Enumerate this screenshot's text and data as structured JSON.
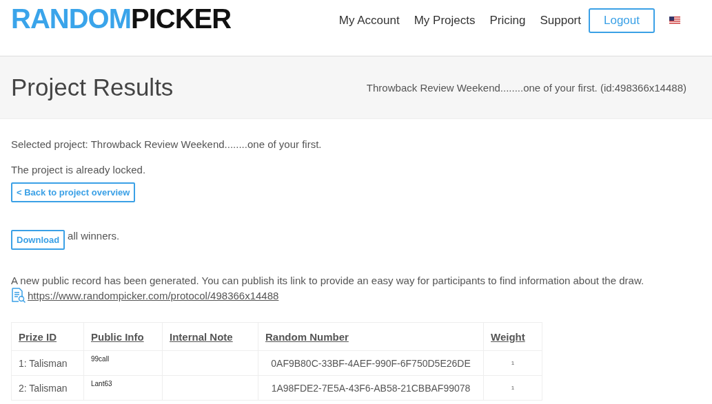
{
  "logo": {
    "first": "RANDOM",
    "second": "PICKER"
  },
  "nav": [
    "My Account",
    "My Projects",
    "Pricing",
    "Support"
  ],
  "logout": "Logout",
  "page": {
    "title": "Project Results",
    "subtitle": "Throwback Review Weekend........one of your first. (id:498366x14488)"
  },
  "selected_project": "Selected project: Throwback Review Weekend........one of your first.",
  "locked_note": "The project is already locked.",
  "back_button": "< Back to project overview",
  "download_button": "Download",
  "download_suffix": "all winners.",
  "record_note": "A new public record has been generated. You can publish its link to provide an easy way for participants to find information about the draw.",
  "record_link": "https://www.randompicker.com/protocol/498366x14488",
  "table": {
    "columns": [
      "Prize ID",
      "Public Info",
      "Internal Note",
      "Random Number",
      "Weight"
    ],
    "rows": [
      {
        "prize_id": "1: Talisman",
        "public_info": "99call",
        "random_number": "0AF9B80C-33BF-4AEF-990F-6F750D5E26DE",
        "weight": "1"
      },
      {
        "prize_id": "2: Talisman",
        "public_info": "Lant63",
        "random_number": "1A98FDE2-7E5A-43F6-AB58-21CBBAF99078",
        "weight": "1"
      }
    ]
  }
}
